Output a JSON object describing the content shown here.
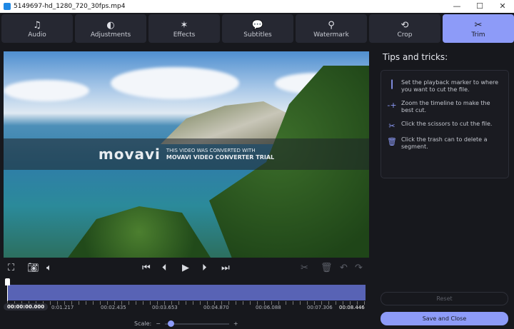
{
  "window": {
    "title": "5149697-hd_1280_720_30fps.mp4",
    "minimize": "—",
    "maximize": "☐",
    "close": "✕"
  },
  "tabs": [
    {
      "label": "Audio",
      "icon": "♫"
    },
    {
      "label": "Adjustments",
      "icon": "◐"
    },
    {
      "label": "Effects",
      "icon": "✶"
    },
    {
      "label": "Subtitles",
      "icon": "💬"
    },
    {
      "label": "Watermark",
      "icon": "⚲"
    },
    {
      "label": "Crop",
      "icon": "⟲"
    },
    {
      "label": "Trim",
      "icon": "✂"
    }
  ],
  "watermark": {
    "logo": "movavi",
    "line1": "THIS VIDEO WAS CONVERTED WITH",
    "line2": "MOVAVI VIDEO CONVERTER TRIAL"
  },
  "timeline": {
    "current": "00:00:00.000",
    "labels": [
      "0:01.217",
      "00:02.435",
      "00:03.653",
      "00:04.870",
      "00:06.088",
      "00:07.306",
      "00:08.446"
    ],
    "position": 0
  },
  "scale": {
    "label": "Scale:",
    "minus": "−",
    "plus": "+",
    "value": 0.1
  },
  "tips": {
    "title": "Tips and tricks:",
    "items": [
      "Set the playback marker to where you want to cut the file.",
      "Zoom the timeline to make the best cut.",
      "Click the scissors to cut the file.",
      "Click the trash can to delete a segment."
    ]
  },
  "buttons": {
    "reset": "Reset",
    "save": "Save and Close"
  }
}
